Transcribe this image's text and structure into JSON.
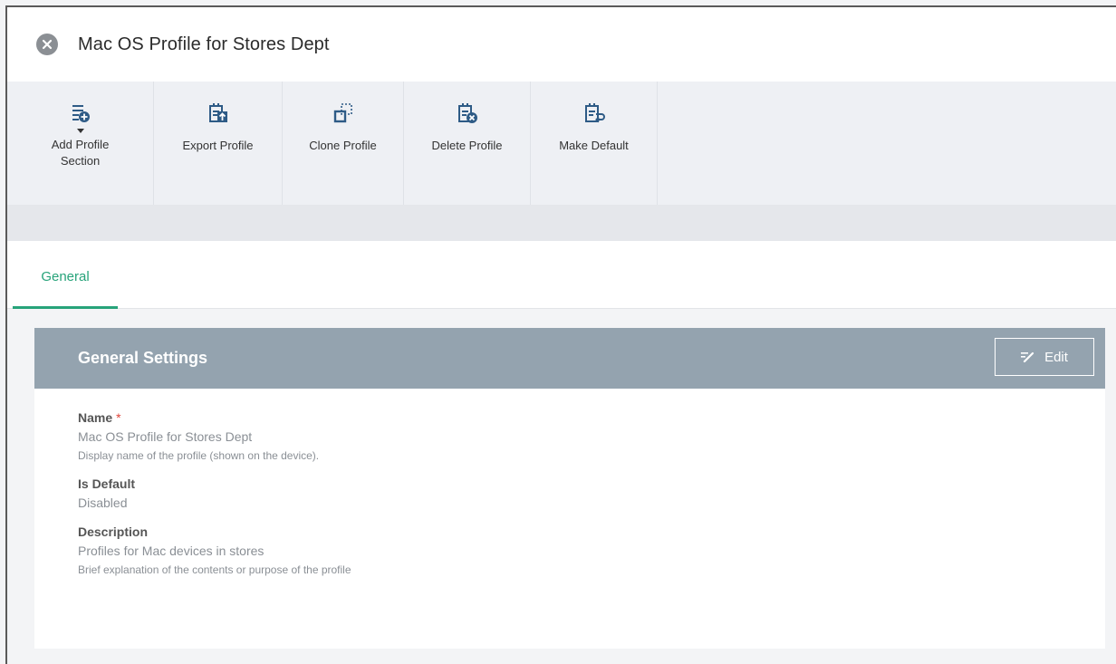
{
  "window": {
    "title": "Mac OS Profile for Stores Dept",
    "close_icon": "close-icon"
  },
  "toolbar": {
    "buttons": [
      {
        "label": "Add Profile Section",
        "icon": "add-section-icon",
        "has_dropdown": true
      },
      {
        "label": "Export Profile",
        "icon": "export-icon"
      },
      {
        "label": "Clone Profile",
        "icon": "clone-icon"
      },
      {
        "label": "Delete Profile",
        "icon": "delete-icon"
      },
      {
        "label": "Make Default",
        "icon": "make-default-icon"
      }
    ]
  },
  "tabs": [
    {
      "label": "General",
      "active": true
    }
  ],
  "panel": {
    "title": "General Settings",
    "edit_label": "Edit",
    "fields": {
      "name": {
        "label": "Name",
        "required_mark": "*",
        "value": "Mac OS Profile for Stores Dept",
        "hint": "Display name of the profile (shown on the device)."
      },
      "is_default": {
        "label": "Is Default",
        "value": "Disabled"
      },
      "description": {
        "label": "Description",
        "value": "Profiles for Mac devices in stores",
        "hint": "Brief explanation of the contents or purpose of the profile"
      }
    }
  },
  "colors": {
    "accent": "#27a37a",
    "panel_header": "#94a3af",
    "required": "#e0443a"
  }
}
